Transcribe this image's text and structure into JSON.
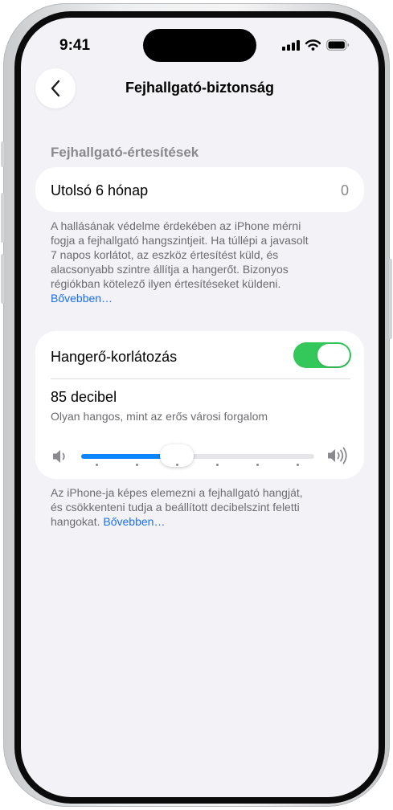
{
  "status_bar": {
    "time": "9:41",
    "icons": [
      "signal-icon",
      "wifi-icon",
      "battery-icon"
    ]
  },
  "nav": {
    "title": "Fejhallgató-biztonság",
    "back_icon": "chevron-left-icon"
  },
  "notifications_section": {
    "header": "Fejhallgató-értesítések",
    "row_label": "Utolsó 6 hónap",
    "row_value": "0",
    "footer_lines": [
      "A hallásának védelme érdekében az iPhone mérni",
      "fogja a fejhallgató hangszintjeit. Ha túllépi a javasolt",
      "7 napos korlátot, az eszköz értesítést küld, és",
      "alacsonyabb szintre állítja a hangerőt. Bizonyos",
      "régiókban kötelező ilyen értesítéseket küldeni."
    ],
    "footer_link": "Bővebben…"
  },
  "volume_limit": {
    "label": "Hangerő-korlátozás",
    "toggle_on": true,
    "decibel": "85 decibel",
    "description": "Olyan hangos, mint az erős városi forgalom",
    "slider_fraction": 0.41,
    "slider_ticks": 6,
    "footer_lines": [
      "Az iPhone-ja képes elemezni a fejhallgató hangját,",
      "és csökkenteni tudja a beállított decibelszint feletti"
    ],
    "footer_last_line": "hangokat.",
    "footer_link": "Bővebben…"
  },
  "colors": {
    "accent": "#0a84ff",
    "toggle_on": "#34c759",
    "link": "#1a6ff0",
    "background": "#f2f2f7"
  }
}
